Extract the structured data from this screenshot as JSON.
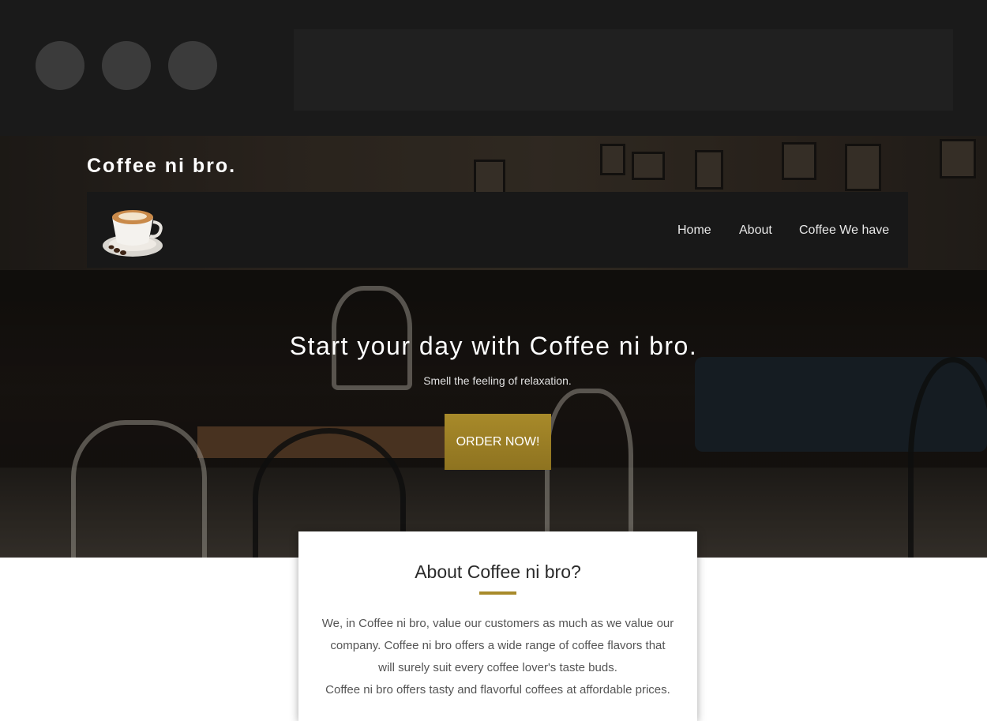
{
  "site": {
    "brand": "Coffee ni bro.",
    "nav": [
      {
        "label": "Home"
      },
      {
        "label": "About"
      },
      {
        "label": "Coffee We have"
      }
    ]
  },
  "hero": {
    "title": "Start your day with Coffee ni bro.",
    "subtitle": "Smell the feeling of relaxation.",
    "cta_label": "ORDER NOW!"
  },
  "about": {
    "title": "About Coffee ni bro?",
    "paragraph1": "We, in Coffee ni bro, value our customers as much as we value our company. Coffee ni bro offers a wide range of coffee flavors that will surely suit every coffee lover's taste buds.",
    "paragraph2": "Coffee ni bro offers tasty and flavorful coffees at affordable prices."
  },
  "colors": {
    "accent": "#a88a2a",
    "navbar": "#181818",
    "chrome": "#1a1a1a"
  }
}
